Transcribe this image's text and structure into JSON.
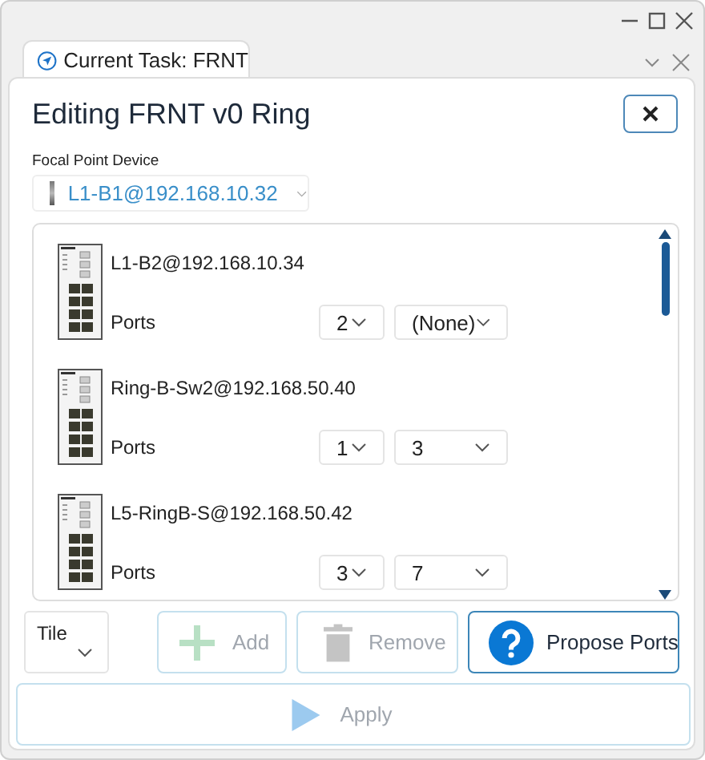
{
  "tab": {
    "label": "Current Task: FRNT",
    "selected": true
  },
  "panel": {
    "title": "Editing FRNT v0 Ring",
    "focal": {
      "label": "Focal Point Device",
      "value": "L1-B1@192.168.10.32"
    },
    "devices": [
      {
        "name": "L1-B2@192.168.10.34",
        "ports_label": "Ports",
        "port_a": "2",
        "port_b": "(None)"
      },
      {
        "name": "Ring-B-Sw2@192.168.50.40",
        "ports_label": "Ports",
        "port_a": "1",
        "port_b": "3"
      },
      {
        "name": "L5-RingB-S@192.168.50.42",
        "ports_label": "Ports",
        "port_a": "3",
        "port_b": "7"
      }
    ],
    "layout_select": "Tile",
    "buttons": [
      {
        "kind": "add",
        "label": "Add",
        "disabled": true
      },
      {
        "kind": "remove",
        "label": "Remove",
        "disabled": true
      },
      {
        "kind": "propose",
        "label": "Propose Ports",
        "disabled": false
      }
    ],
    "apply": {
      "label": "Apply",
      "disabled": true
    }
  }
}
